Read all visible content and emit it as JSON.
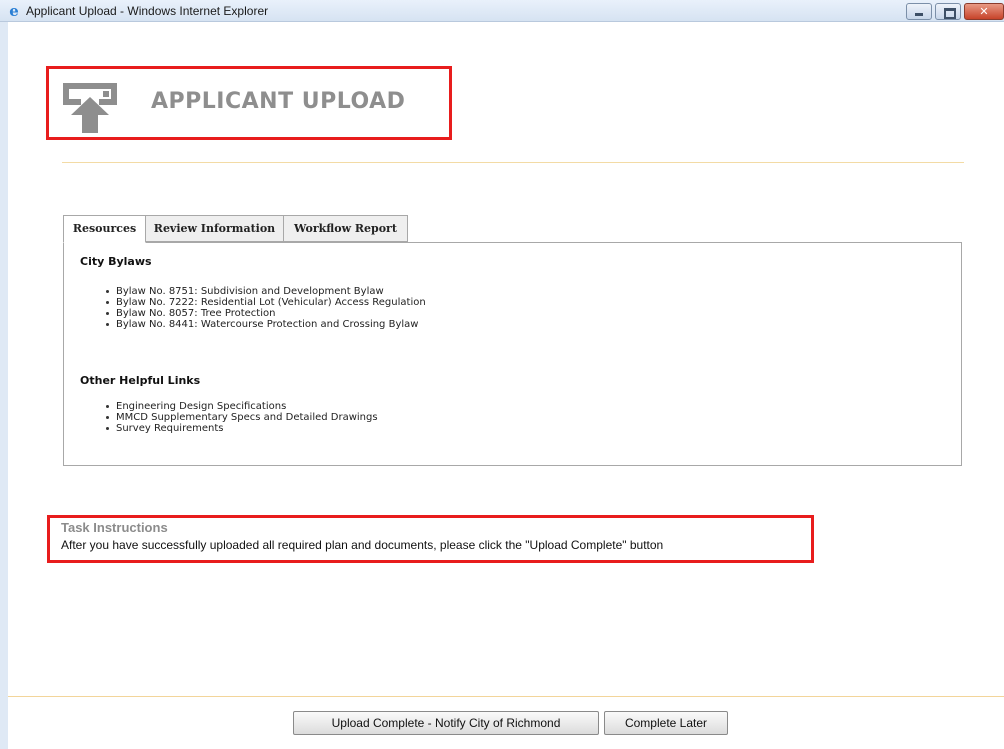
{
  "window": {
    "title": "Applicant Upload - Windows Internet Explorer"
  },
  "header": {
    "title": "APPLICANT UPLOAD",
    "icon": "upload-icon"
  },
  "tabs": [
    {
      "label": "Resources",
      "active": true
    },
    {
      "label": "Review Information",
      "active": false
    },
    {
      "label": "Workflow Report",
      "active": false
    }
  ],
  "resources": {
    "city_bylaws": {
      "heading": "City Bylaws",
      "items": [
        "Bylaw No. 8751: Subdivision and Development Bylaw",
        "Bylaw No. 7222: Residential Lot (Vehicular) Access Regulation",
        "Bylaw No. 8057: Tree Protection",
        "Bylaw No. 8441: Watercourse Protection and Crossing Bylaw"
      ]
    },
    "other_links": {
      "heading": "Other Helpful Links",
      "items": [
        "Engineering Design Specifications",
        "MMCD Supplementary Specs and Detailed Drawings",
        "Survey Requirements"
      ]
    }
  },
  "task": {
    "title": "Task Instructions",
    "text": "After you have successfully uploaded all required plan and documents, please click the \"Upload Complete\" button"
  },
  "buttons": {
    "upload_complete": "Upload Complete - Notify City of Richmond",
    "complete_later": "Complete Later"
  },
  "colors": {
    "highlight_border": "#e81d1d",
    "title_gray": "#8e8e8e",
    "divider": "#f3dba5"
  }
}
